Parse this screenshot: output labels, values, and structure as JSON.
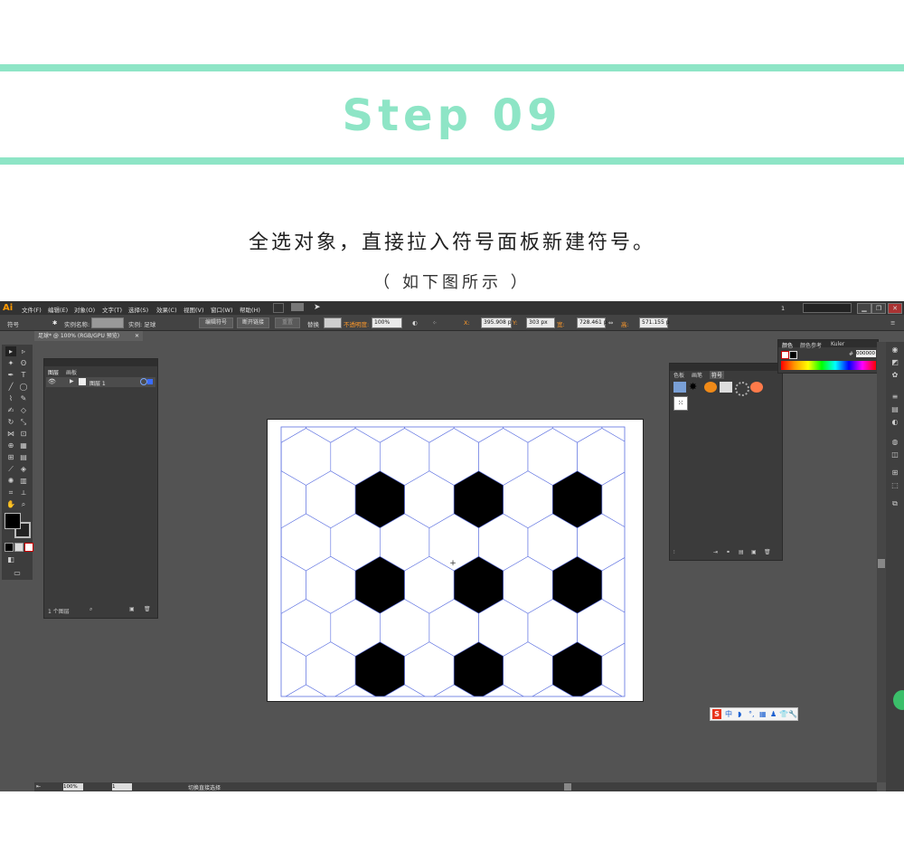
{
  "step": {
    "title": "Step 09"
  },
  "instruction": {
    "caption": "全选对象，直接拉入符号面板新建符号。",
    "sub_caption": "（ 如下图所示 ）"
  },
  "colors": {
    "accent": "#8ee5c6",
    "app_bg": "#535353",
    "menubar": "#323232"
  },
  "app": {
    "logo": "Ai",
    "menu": [
      "文件(F)",
      "编辑(E)",
      "对象(O)",
      "文字(T)",
      "选择(S)",
      "效果(C)",
      "视图(V)",
      "窗口(W)",
      "帮助(H)"
    ],
    "workspace_num": "1",
    "control_bar": {
      "type_label": "符号",
      "instance_name_label": "实例名称:",
      "instance_of_label": "实例: 足球",
      "edit_symbol": "编辑符号",
      "break_link": "断开链接",
      "reset": "重置",
      "replace": "替换",
      "opacity_label": "不透明度:",
      "opacity_value": "100%",
      "x_label": "X:",
      "x_value": "395.908 p",
      "y_label": "Y:",
      "y_value": "303 px",
      "w_label": "宽:",
      "w_value": "728.461 p",
      "h_label": "高:",
      "h_value": "571.155 p"
    },
    "document_tab": "足球* @ 100% (RGB/GPU 预览)",
    "layers_panel": {
      "tab_layers": "图层",
      "tab_artboards": "画板",
      "layer_name": "图层 1",
      "count_label": "1 个图层"
    },
    "symbols_panel": {
      "tab_color_guide": "色板",
      "tab_brushes": "画笔",
      "tab_symbols": "符号"
    },
    "color_panel": {
      "tab_color": "颜色",
      "tab_color_ref": "颜色参考",
      "tab_kuler": "Kuler",
      "hex_value": "000000"
    },
    "status_bar": {
      "zoom": "100%",
      "page": "1",
      "mode": "切换直接选择"
    },
    "ime": {
      "logo": "S",
      "lang": "中"
    }
  }
}
